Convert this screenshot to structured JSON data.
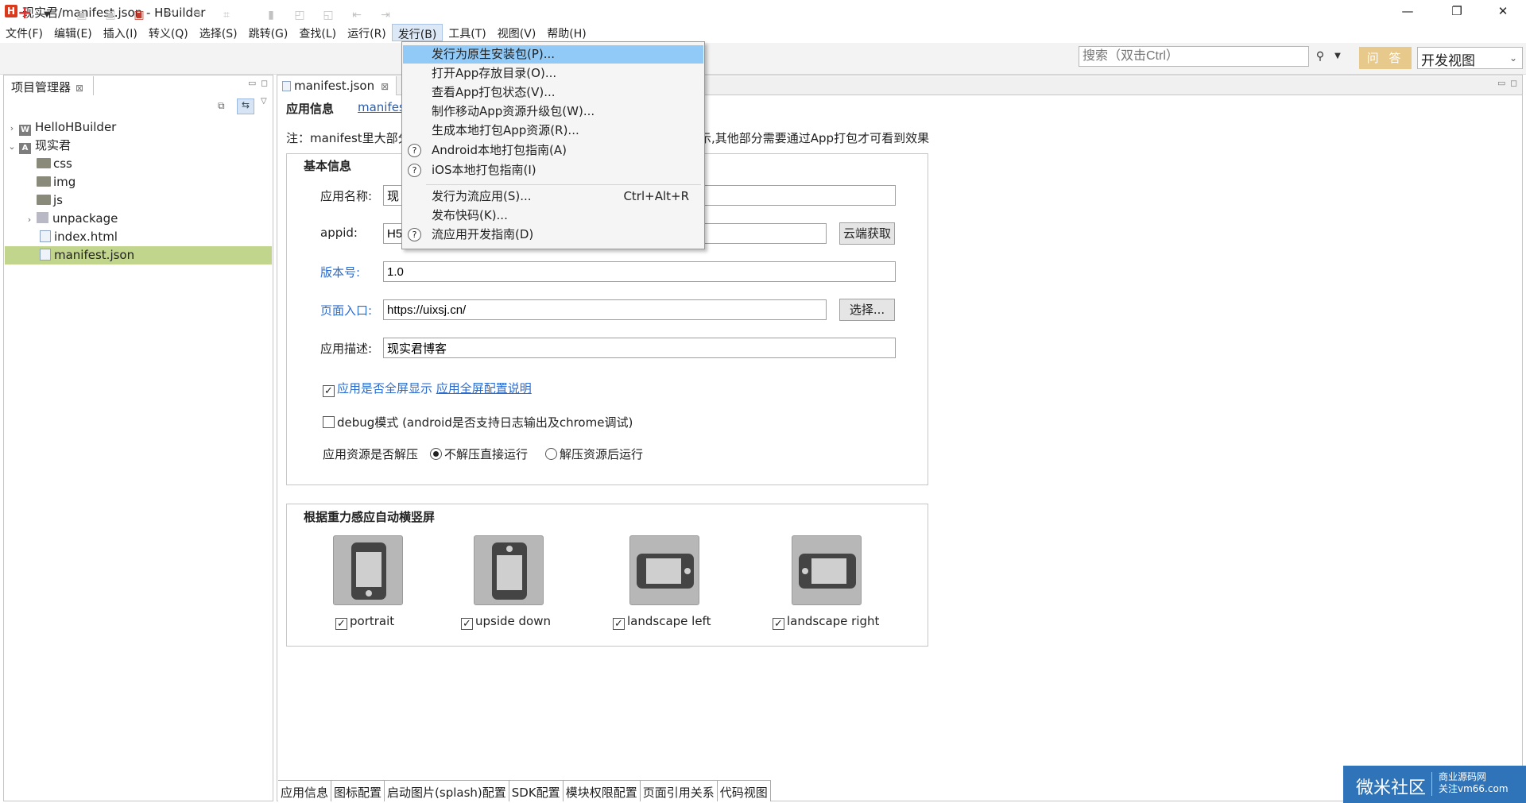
{
  "window": {
    "app_logo": "H",
    "title": "现实君/manifest.json  -  HBuilder",
    "minimize": "—",
    "maximize": "❐",
    "close": "✕"
  },
  "menubar": [
    {
      "label": "文件(F)"
    },
    {
      "label": "编辑(E)"
    },
    {
      "label": "插入(I)"
    },
    {
      "label": "转义(Q)"
    },
    {
      "label": "选择(S)"
    },
    {
      "label": "跳转(G)"
    },
    {
      "label": "查找(L)"
    },
    {
      "label": "运行(R)"
    },
    {
      "label": "发行(B)"
    },
    {
      "label": "工具(T)"
    },
    {
      "label": "视图(V)"
    },
    {
      "label": "帮助(H)"
    }
  ],
  "toolbar": {
    "search_placeholder": "搜索（双击Ctrl）",
    "ask_label": "问 答",
    "view_select": "开发视图"
  },
  "project_manager": {
    "tab_label": "项目管理器",
    "tree": [
      {
        "label": "HelloHBuilder",
        "type": "project"
      },
      {
        "label": "现实君",
        "type": "project"
      },
      {
        "label": "css",
        "type": "folder"
      },
      {
        "label": "img",
        "type": "folder"
      },
      {
        "label": "js",
        "type": "folder"
      },
      {
        "label": "unpackage",
        "type": "package"
      },
      {
        "label": "index.html",
        "type": "file"
      },
      {
        "label": "manifest.json",
        "type": "file"
      }
    ]
  },
  "editor": {
    "tab_label": "manifest.json",
    "sub_tab": "应用信息",
    "link_tab": "manifes",
    "note_left": "注：manifest里大部分",
    "note_right": "示,其他部分需要通过App打包才可看到效果",
    "basic_group": {
      "title": "基本信息",
      "app_name_label": "应用名称:",
      "app_name_value": "现",
      "appid_label": "appid:",
      "appid_value": "H5",
      "cloud_btn": "云端获取",
      "version_label": "版本号:",
      "version_value": "1.0",
      "entry_label": "页面入口:",
      "entry_value": "https://uixsj.cn/",
      "choose_btn": "选择...",
      "desc_label": "应用描述:",
      "desc_value": "现实君博客",
      "fullscreen_label": "应用是否全屏显示",
      "fullscreen_link": "应用全屏配置说明",
      "debug_label": "debug模式 (android是否支持日志输出及chrome调试)",
      "unzip_label": "应用资源是否解压",
      "radio1": "不解压直接运行",
      "radio2": "解压资源后运行"
    },
    "orient_group": {
      "title": "根据重力感应自动横竖屏",
      "items": [
        {
          "label": "portrait",
          "checked": "☑"
        },
        {
          "label": "upside down",
          "checked": "☑"
        },
        {
          "label": "landscape left",
          "checked": "☑"
        },
        {
          "label": "landscape right",
          "checked": "☑"
        }
      ]
    },
    "bottom_tabs": [
      {
        "label": "应用信息"
      },
      {
        "label": "图标配置"
      },
      {
        "label": "启动图片(splash)配置"
      },
      {
        "label": "SDK配置"
      },
      {
        "label": "模块权限配置"
      },
      {
        "label": "页面引用关系"
      },
      {
        "label": "代码视图"
      }
    ]
  },
  "dropdown": {
    "items": [
      {
        "label": "发行为原生安装包(P)...",
        "help": false,
        "accel": ""
      },
      {
        "label": "打开App存放目录(O)...",
        "help": false,
        "accel": ""
      },
      {
        "label": "查看App打包状态(V)...",
        "help": false,
        "accel": ""
      },
      {
        "label": "制作移动App资源升级包(W)...",
        "help": false,
        "accel": ""
      },
      {
        "label": "生成本地打包App资源(R)...",
        "help": false,
        "accel": ""
      },
      {
        "label": "Android本地打包指南(A)",
        "help": true,
        "accel": ""
      },
      {
        "label": "iOS本地打包指南(I)",
        "help": true,
        "accel": ""
      },
      {
        "label": "发行为流应用(S)...",
        "help": false,
        "accel": "Ctrl+Alt+R"
      },
      {
        "label": "发布快码(K)...",
        "help": false,
        "accel": ""
      },
      {
        "label": "流应用开发指南(D)",
        "help": true,
        "accel": ""
      }
    ],
    "help_glyph": "?"
  },
  "watermark": {
    "main": "微米社区",
    "sub1": "商业源码网",
    "sub2": "关注vm66.com"
  }
}
